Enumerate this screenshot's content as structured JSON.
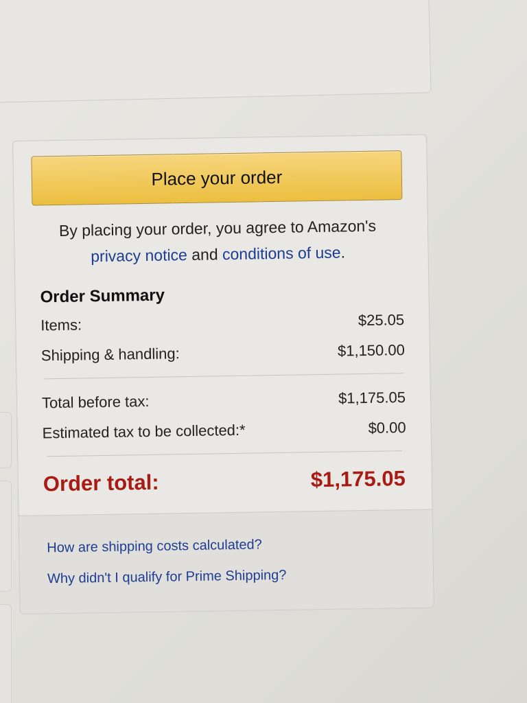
{
  "summary": {
    "place_order_label": "Place your order",
    "agree_prefix": "By placing your order, you agree to Amazon's",
    "privacy_link": "privacy notice",
    "agree_and": "and",
    "conditions_link": "conditions of use",
    "agree_suffix": ".",
    "title": "Order Summary",
    "rows": [
      {
        "label": "Items:",
        "value": "$25.05"
      },
      {
        "label": "Shipping & handling:",
        "value": "$1,150.00"
      },
      {
        "label": "Total before tax:",
        "value": "$1,175.05"
      },
      {
        "label": "Estimated tax to be collected:*",
        "value": "$0.00"
      }
    ],
    "total_label": "Order total:",
    "total_value": "$1,175.05"
  },
  "help": {
    "links": [
      "How are shipping costs calculated?",
      "Why didn't I qualify for Prime Shipping?"
    ]
  },
  "colors": {
    "button": "#ecbf40",
    "link": "#1c3d91",
    "total": "#a81b12"
  }
}
